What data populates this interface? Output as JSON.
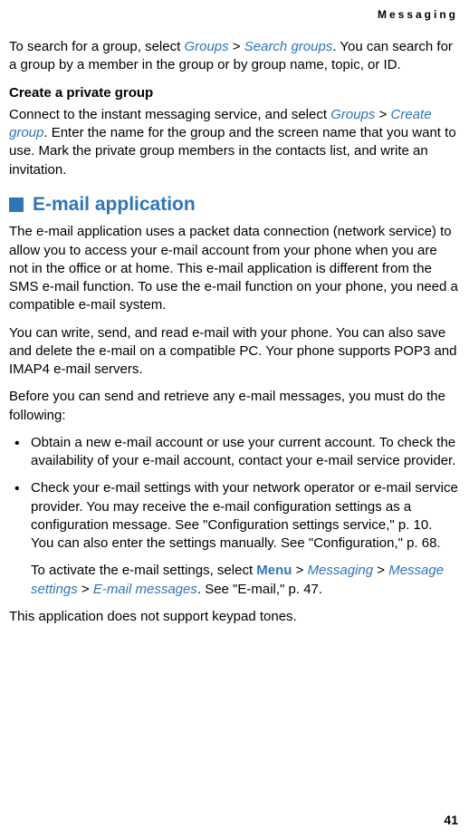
{
  "header": {
    "category": "Messaging"
  },
  "body": {
    "p1_a": "To search for a group, select ",
    "p1_link1": "Groups",
    "p1_b": " > ",
    "p1_link2": "Search groups",
    "p1_c": ". You can search for a group by a member in the group or by group name, topic, or ID.",
    "h1": "Create a private group",
    "p2_a": "Connect to the instant messaging service, and select ",
    "p2_link1": "Groups",
    "p2_b": " > ",
    "p2_link2": "Create group",
    "p2_c": ". Enter the name for the group and the screen name that you want to use. Mark the private group members in the contacts list, and write an invitation.",
    "section_title": "E-mail application",
    "p3": "The e-mail application uses a packet data connection (network service) to allow you to access your e-mail account from your phone when you are not in the office or at home. This e-mail application is different from the SMS e-mail function. To use the e-mail function on your phone, you need a compatible e-mail system.",
    "p4": "You can write, send, and read e-mail with your phone. You can also save and delete the e-mail on a compatible PC. Your phone supports POP3 and IMAP4 e-mail servers.",
    "p5": "Before you can send and retrieve any e-mail messages, you must do the following:",
    "li1": "Obtain a new e-mail account or use your current account. To check the availability of your e-mail account, contact your e-mail service provider.",
    "li2": "Check your e-mail settings with your network operator or e-mail service provider. You may receive the e-mail configuration settings as a configuration message. See \"Configuration settings service,\" p. 10. You can also enter the settings manually. See \"Configuration,\" p. 68.",
    "p6_a": "To activate the e-mail settings, select ",
    "p6_link1": "Menu",
    "p6_b": " > ",
    "p6_link2": "Messaging",
    "p6_c": " > ",
    "p6_link3": "Message settings",
    "p6_d": " > ",
    "p6_link4": "E-mail messages",
    "p6_e": ". See \"E-mail,\" p. 47.",
    "p7": "This application does not support keypad tones."
  },
  "footer": {
    "page_number": "41"
  }
}
